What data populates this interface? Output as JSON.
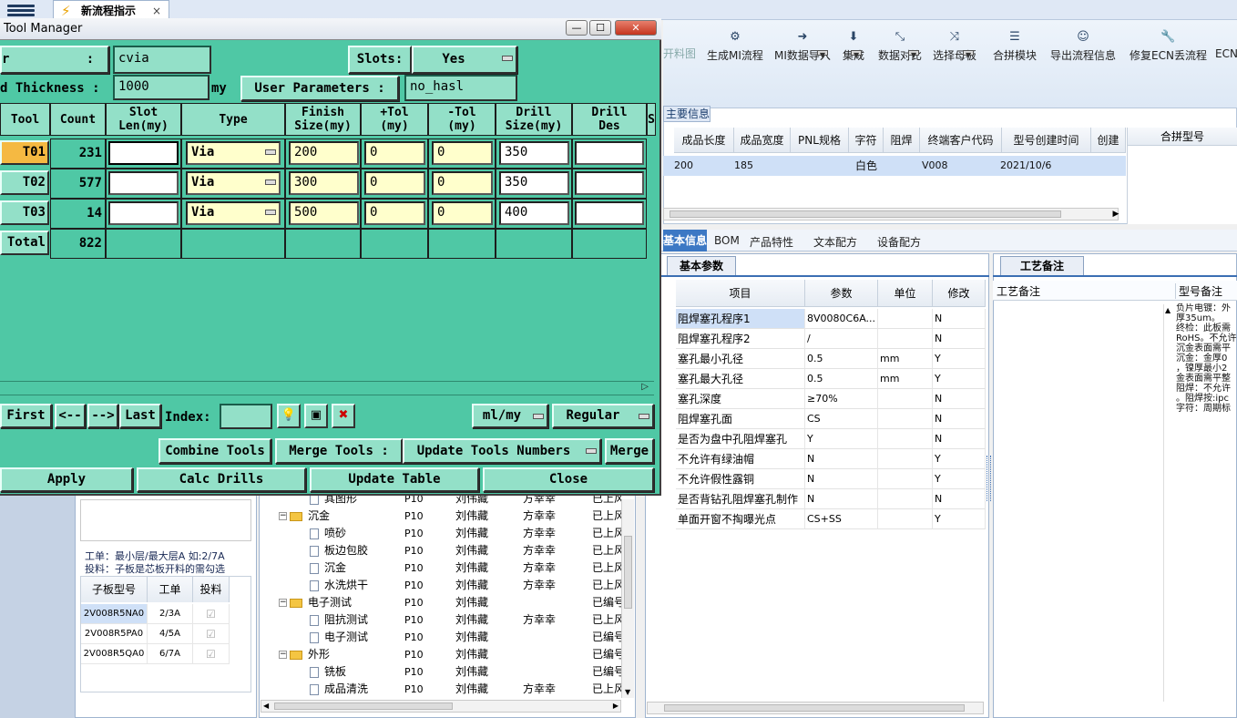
{
  "app": {
    "flow_tab_label": "新流程指示",
    "flow_tab_close": "×"
  },
  "ribbon": {
    "partial_first": "开料图",
    "items": [
      {
        "label": "生成MI流程",
        "icon": "share-icon"
      },
      {
        "label": "MI数据导入",
        "icon": "import-icon"
      },
      {
        "label": "集成",
        "icon": "download-icon"
      },
      {
        "label": "数据对比",
        "icon": "compare-icon"
      },
      {
        "label": "选择母板",
        "icon": "shuffle-icon"
      },
      {
        "label": "合拼模块",
        "icon": "list-icon"
      },
      {
        "label": "导出流程信息",
        "icon": "smile-icon"
      },
      {
        "label": "修复ECN丢流程",
        "icon": "wrench-icon"
      },
      {
        "label": "ECN"
      }
    ]
  },
  "model_table": {
    "tab_label": "主要信息",
    "headers": [
      "成品长度",
      "成品宽度",
      "PNL规格",
      "字符",
      "阻焊",
      "终端客户代码",
      "型号创建时间",
      "创建"
    ],
    "row": [
      "200",
      "185",
      "",
      "白色",
      "",
      "V008",
      "2021/10/6",
      ""
    ],
    "merge_header": "合拼型号"
  },
  "tabs2": [
    "基本信息",
    "BOM",
    "产品特性",
    "文本配方",
    "设备配方"
  ],
  "basic_params": {
    "tab_label": "基本参数",
    "headers": [
      "项目",
      "参数",
      "单位",
      "修改"
    ],
    "rows": [
      [
        "阻焊塞孔程序1",
        "8V0080C6A...",
        "",
        "N"
      ],
      [
        "阻焊塞孔程序2",
        "/",
        "",
        "N"
      ],
      [
        "塞孔最小孔径",
        "0.5",
        "mm",
        "Y"
      ],
      [
        "塞孔最大孔径",
        "0.5",
        "mm",
        "Y"
      ],
      [
        "塞孔深度",
        "≥70%",
        "",
        "N"
      ],
      [
        "阻焊塞孔面",
        "CS",
        "",
        "N"
      ],
      [
        "是否为盘中孔阻焊塞孔",
        "Y",
        "",
        "N"
      ],
      [
        "不允许有绿油帽",
        "N",
        "",
        "Y"
      ],
      [
        "不允许假性露铜",
        "N",
        "",
        "Y"
      ],
      [
        "是否背钻孔阻焊塞孔制作",
        "N",
        "",
        "N"
      ],
      [
        "单面开窗不掏曝光点",
        "CS+SS",
        "",
        "Y"
      ]
    ]
  },
  "process_remarks": {
    "tab_label": "工艺备注",
    "col1": "工艺备注",
    "col2": "型号备注",
    "remarks_text": "负片电镀：外\n厚35um。\n终检：此板需\nRoHS。不允许\n沉金表面需平\n沉金：金厚0\n，镍厚最小2\n金表面需平整\n阻焊：不允许\n。阻焊按:ipc\n字符：周期标"
  },
  "bottom_left": {
    "note1": "工单：最小层/最大层A 如:2/7A",
    "note2": "投料：子板是芯板开料的需勾选",
    "headers": [
      "子板型号",
      "工单",
      "投料"
    ],
    "rows": [
      [
        "2V008R5NA0",
        "2/3A",
        "☑"
      ],
      [
        "2V008R5PA0",
        "4/5A",
        "☑"
      ],
      [
        "2V008R5QA0",
        "6/7A",
        "☑"
      ]
    ]
  },
  "tree": {
    "rows": [
      {
        "indent": 1,
        "kind": "doc",
        "name": "其图形",
        "code": "P10",
        "p1": "刘伟藏",
        "p2": "方幸幸",
        "st": "已上风"
      },
      {
        "indent": 0,
        "kind": "folder",
        "name": "沉金",
        "code": "P10",
        "p1": "刘伟藏",
        "p2": "方幸幸",
        "st": "已上风"
      },
      {
        "indent": 1,
        "kind": "doc",
        "name": "喷砂",
        "code": "P10",
        "p1": "刘伟藏",
        "p2": "方幸幸",
        "st": "已上风"
      },
      {
        "indent": 1,
        "kind": "doc",
        "name": "板边包胶",
        "code": "P10",
        "p1": "刘伟藏",
        "p2": "方幸幸",
        "st": "已上风"
      },
      {
        "indent": 1,
        "kind": "doc",
        "name": "沉金",
        "code": "P10",
        "p1": "刘伟藏",
        "p2": "方幸幸",
        "st": "已上风"
      },
      {
        "indent": 1,
        "kind": "doc",
        "name": "水洗烘干",
        "code": "P10",
        "p1": "刘伟藏",
        "p2": "方幸幸",
        "st": "已上风"
      },
      {
        "indent": 0,
        "kind": "folder",
        "name": "电子测试",
        "code": "P10",
        "p1": "刘伟藏",
        "p2": "",
        "st": "已编号"
      },
      {
        "indent": 1,
        "kind": "doc",
        "name": "阻抗测试",
        "code": "P10",
        "p1": "刘伟藏",
        "p2": "方幸幸",
        "st": "已上风"
      },
      {
        "indent": 1,
        "kind": "doc",
        "name": "电子测试",
        "code": "P10",
        "p1": "刘伟藏",
        "p2": "",
        "st": "已编号"
      },
      {
        "indent": 0,
        "kind": "folder",
        "name": "外形",
        "code": "P10",
        "p1": "刘伟藏",
        "p2": "",
        "st": "已编号"
      },
      {
        "indent": 1,
        "kind": "doc",
        "name": "铣板",
        "code": "P10",
        "p1": "刘伟藏",
        "p2": "",
        "st": "已编号"
      },
      {
        "indent": 1,
        "kind": "doc",
        "name": "成品清洗",
        "code": "P10",
        "p1": "刘伟藏",
        "p2": "方幸幸",
        "st": "已上风"
      }
    ]
  },
  "tool_manager": {
    "title": "Tool Manager",
    "win_min": "—",
    "win_max": "☐",
    "win_close": "✕",
    "layer_label": "r          :",
    "layer_value": "cvia",
    "slots_label": "Slots:",
    "slots_value": "Yes",
    "thickness_label": "d Thickness :",
    "thickness_value": "1000",
    "thickness_unit": "my",
    "user_params_label": "User Parameters :",
    "user_params_value": "no_hasl",
    "headers": [
      "Tool",
      "Count",
      "Slot\nLen(my)",
      "Type",
      "Finish\nSize(my)",
      "+Tol\n(my)",
      "-Tol\n(my)",
      "Drill\nSize(my)",
      "Drill\nDes",
      "S"
    ],
    "rows": [
      {
        "tool": "T01",
        "count": "231",
        "slot": "",
        "type": "Via",
        "finish": "200",
        "ptol": "0",
        "mtol": "0",
        "drill": "350",
        "des": ""
      },
      {
        "tool": "T02",
        "count": "577",
        "slot": "",
        "type": "Via",
        "finish": "300",
        "ptol": "0",
        "mtol": "0",
        "drill": "350",
        "des": ""
      },
      {
        "tool": "T03",
        "count": "14",
        "slot": "",
        "type": "Via",
        "finish": "500",
        "ptol": "0",
        "mtol": "0",
        "drill": "400",
        "des": ""
      }
    ],
    "total_label": "Total",
    "total_count": "822",
    "nav": {
      "first": "First",
      "prev": "<--",
      "next": "-->",
      "last": "Last",
      "index_label": "Index:",
      "index_value": "",
      "units": "ml/my",
      "mode": "Regular"
    },
    "actions": {
      "combine": "Combine Tools",
      "merge_label": "Merge Tools :",
      "update_numbers": "Update Tools Numbers",
      "merge": "Merge"
    },
    "bottom": {
      "apply": "Apply",
      "calc": "Calc Drills",
      "update_table": "Update Table",
      "close": "Close"
    }
  }
}
